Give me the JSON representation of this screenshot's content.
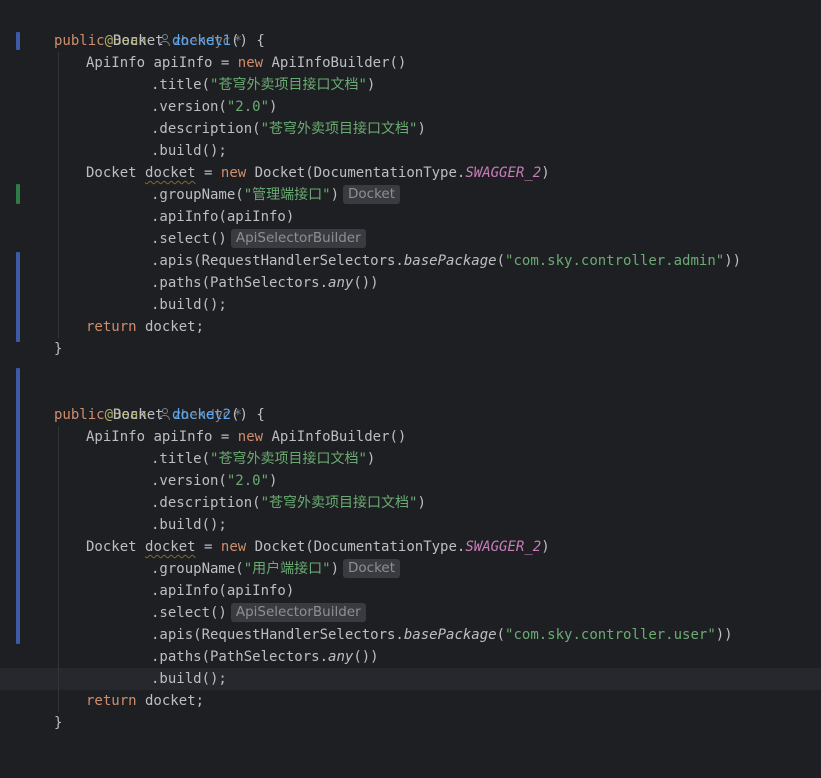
{
  "editor": {
    "language": "Java",
    "colors": {
      "keyword": "#cf8e6d",
      "annotation": "#b3ae60",
      "method_name": "#56a8f5",
      "string": "#6aab73",
      "constant": "#c77dbb",
      "text": "#bcbec4",
      "background": "#1e1f22",
      "vcs_modified": "#3d5ba5",
      "vcs_added": "#2f7a45"
    },
    "blocks": [
      {
        "annotation": "@Bean",
        "author": "zhendyc *",
        "kw_public": "public",
        "return_type": "Docket",
        "method_name": "docket1",
        "method_open": "() {",
        "apiinfo_type": "ApiInfo",
        "apiinfo_var": "apiInfo",
        "eq": " = ",
        "kw_new": "new",
        "builder_call": "ApiInfoBuilder()",
        "title_call": ".title(",
        "title_value": "\"苍穹外卖项目接口文档\"",
        "close_paren": ")",
        "version_call": ".version(",
        "version_value": "\"2.0\"",
        "description_call": ".description(",
        "description_value": "\"苍穹外卖项目接口文档\"",
        "build_call": ".build();",
        "docket_type": "Docket",
        "docket_var": "docket",
        "docket_ctor": "Docket(DocumentationType.",
        "swagger_const": "SWAGGER_2",
        "group_call": ".groupName(",
        "group_value": "\"管理端接口\"",
        "group_hint": "Docket",
        "apiinfo_call": ".apiInfo(apiInfo)",
        "select_call": ".select()",
        "select_hint": "ApiSelectorBuilder",
        "apis_call": ".apis(RequestHandlerSelectors.",
        "base_package": "basePackage",
        "open_paren": "(",
        "package_value": "\"com.sky.controller.admin\"",
        "double_close": "))",
        "paths_call": ".paths(PathSelectors.",
        "any_call": "any",
        "paths_close": "())",
        "final_build": ".build();",
        "kw_return": "return",
        "return_value": " docket;",
        "closing_brace": "}"
      },
      {
        "annotation": "@Bean",
        "author": "zhendyc *",
        "kw_public": "public",
        "return_type": "Docket",
        "method_name": "docket2",
        "method_open": "() {",
        "apiinfo_type": "ApiInfo",
        "apiinfo_var": "apiInfo",
        "eq": " = ",
        "kw_new": "new",
        "builder_call": "ApiInfoBuilder()",
        "title_call": ".title(",
        "title_value": "\"苍穹外卖项目接口文档\"",
        "close_paren": ")",
        "version_call": ".version(",
        "version_value": "\"2.0\"",
        "description_call": ".description(",
        "description_value": "\"苍穹外卖项目接口文档\"",
        "build_call": ".build();",
        "docket_type": "Docket",
        "docket_var": "docket",
        "docket_ctor": "Docket(DocumentationType.",
        "swagger_const": "SWAGGER_2",
        "group_call": ".groupName(",
        "group_value": "\"用户端接口\"",
        "group_hint": "Docket",
        "apiinfo_call": ".apiInfo(apiInfo)",
        "select_call": ".select()",
        "select_hint": "ApiSelectorBuilder",
        "apis_call": ".apis(RequestHandlerSelectors.",
        "base_package": "basePackage",
        "open_paren": "(",
        "package_value": "\"com.sky.controller.user\"",
        "double_close": "))",
        "paths_call": ".paths(PathSelectors.",
        "any_call": "any",
        "paths_close": "())",
        "final_build": ".build();",
        "kw_return": "return",
        "return_value": " docket;",
        "closing_brace": "}"
      }
    ]
  }
}
